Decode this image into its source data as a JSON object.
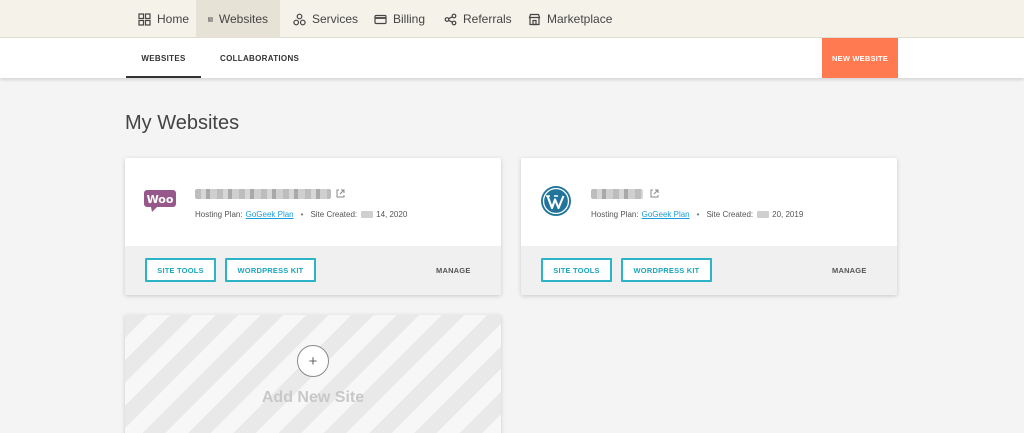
{
  "topnav": {
    "items": [
      {
        "label": "Home",
        "icon": "grid-icon"
      },
      {
        "label": "Websites",
        "icon": "browser-icon",
        "active": true
      },
      {
        "label": "Services",
        "icon": "services-icon"
      },
      {
        "label": "Billing",
        "icon": "card-icon"
      },
      {
        "label": "Referrals",
        "icon": "share-icon"
      },
      {
        "label": "Marketplace",
        "icon": "store-icon"
      }
    ]
  },
  "subnav": {
    "tabs": [
      {
        "label": "WEBSITES",
        "active": true
      },
      {
        "label": "COLLABORATIONS"
      }
    ],
    "new_website_label": "NEW WEBSITE"
  },
  "page_title": "My Websites",
  "sites": [
    {
      "logo": "woocommerce-logo",
      "logo_text": "Woo",
      "hosting_plan_label": "Hosting Plan:",
      "hosting_plan": "GoGeek Plan",
      "created_label": "Site Created:",
      "created_date": "14, 2020",
      "site_tools_label": "SITE TOOLS",
      "wordpress_kit_label": "WORDPRESS KIT",
      "manage_label": "MANAGE"
    },
    {
      "logo": "wordpress-logo",
      "hosting_plan_label": "Hosting Plan:",
      "hosting_plan": "GoGeek Plan",
      "created_label": "Site Created:",
      "created_date": "20, 2019",
      "site_tools_label": "SITE TOOLS",
      "wordpress_kit_label": "WORDPRESS KIT",
      "manage_label": "MANAGE"
    }
  ],
  "add_site": {
    "label": "Add New Site",
    "symbol": "+"
  },
  "colors": {
    "accent_orange": "#ff7a50",
    "button_teal": "#2bb3c8",
    "link_blue": "#1b9dd9",
    "woo_purple": "#96588a",
    "wordpress_blue": "#21759b"
  }
}
